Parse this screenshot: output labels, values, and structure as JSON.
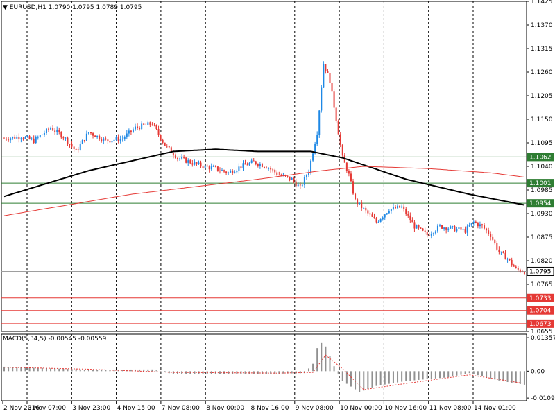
{
  "header": {
    "arrow": "▼",
    "symbol": "EURUSD,H1",
    "ohlc": "1.0790 1.0795 1.0789 1.0795"
  },
  "macd": {
    "label": "MACD(5,34,5)",
    "values": "-0.00545 -0.00559"
  },
  "colors": {
    "bull": "#1e88e5",
    "bear": "#e53935",
    "ma_slow": "#000000",
    "ma_fast": "#e53935",
    "support": "#e53935",
    "resistance": "#2e7d32",
    "current": "#9e9e9e"
  },
  "chart_data": {
    "type": "candlestick",
    "symbol": "EURUSD",
    "timeframe": "H1",
    "ylim": [
      1.0655,
      1.1425
    ],
    "y_ticks": [
      "1.1425",
      "1.1370",
      "1.1315",
      "1.1260",
      "1.1205",
      "1.1150",
      "1.1095",
      "1.1040",
      "1.0985",
      "1.0930",
      "1.0875",
      "1.0820",
      "1.0765",
      "1.0655"
    ],
    "x_ticks": [
      "2 Nov 2016",
      "3 Nov 07:00",
      "3 Nov 23:00",
      "4 Nov 15:00",
      "7 Nov 08:00",
      "8 Nov 00:00",
      "8 Nov 16:00",
      "9 Nov 08:00",
      "10 Nov 00:00",
      "10 Nov 16:00",
      "11 Nov 08:00",
      "14 Nov 01:00"
    ],
    "current_price": "1.0795",
    "levels": [
      {
        "value": "1.1062",
        "kind": "resistance"
      },
      {
        "value": "1.1001",
        "kind": "resistance"
      },
      {
        "value": "1.0954",
        "kind": "resistance"
      },
      {
        "value": "1.0733",
        "kind": "support"
      },
      {
        "value": "1.0704",
        "kind": "support"
      },
      {
        "value": "1.0673",
        "kind": "support"
      }
    ],
    "anchors": [
      [
        0,
        1.1105
      ],
      [
        8,
        1.111
      ],
      [
        14,
        1.11
      ],
      [
        22,
        1.113
      ],
      [
        28,
        1.111
      ],
      [
        34,
        1.1075
      ],
      [
        40,
        1.112
      ],
      [
        48,
        1.11
      ],
      [
        56,
        1.1105
      ],
      [
        62,
        1.113
      ],
      [
        70,
        1.114
      ],
      [
        76,
        1.109
      ],
      [
        82,
        1.106
      ],
      [
        88,
        1.105
      ],
      [
        94,
        1.104
      ],
      [
        100,
        1.1035
      ],
      [
        106,
        1.1025
      ],
      [
        112,
        1.104
      ],
      [
        118,
        1.105
      ],
      [
        124,
        1.104
      ],
      [
        130,
        1.102
      ],
      [
        136,
        1.101
      ],
      [
        140,
        1.099
      ],
      [
        144,
        1.103
      ],
      [
        148,
        1.112
      ],
      [
        151,
        1.128
      ],
      [
        154,
        1.124
      ],
      [
        157,
        1.115
      ],
      [
        160,
        1.106
      ],
      [
        163,
        1.102
      ],
      [
        166,
        1.096
      ],
      [
        170,
        1.094
      ],
      [
        176,
        1.091
      ],
      [
        182,
        1.094
      ],
      [
        188,
        1.0945
      ],
      [
        194,
        1.09
      ],
      [
        200,
        1.088
      ],
      [
        206,
        1.09
      ],
      [
        212,
        1.0895
      ],
      [
        218,
        1.089
      ],
      [
        222,
        1.091
      ],
      [
        226,
        1.09
      ],
      [
        230,
        1.088
      ],
      [
        234,
        1.084
      ],
      [
        238,
        1.0825
      ],
      [
        242,
        1.08
      ],
      [
        246,
        1.0795
      ]
    ],
    "ma_slow": [
      [
        0,
        1.097
      ],
      [
        40,
        1.103
      ],
      [
        80,
        1.1075
      ],
      [
        100,
        1.108
      ],
      [
        120,
        1.1075
      ],
      [
        145,
        1.1075
      ],
      [
        160,
        1.106
      ],
      [
        190,
        1.101
      ],
      [
        220,
        1.0975
      ],
      [
        246,
        1.095
      ]
    ],
    "ma_fast": [
      [
        0,
        1.0925
      ],
      [
        60,
        1.0975
      ],
      [
        120,
        1.101
      ],
      [
        150,
        1.103
      ],
      [
        170,
        1.104
      ],
      [
        200,
        1.1035
      ],
      [
        230,
        1.1025
      ],
      [
        246,
        1.1015
      ]
    ],
    "macd_ylim": [
      -0.012,
      0.015
    ],
    "macd_ticks": [
      "0.01357",
      "0.00",
      "-0.01091"
    ],
    "macd_anchors": [
      [
        0,
        0.0018
      ],
      [
        40,
        0.0006
      ],
      [
        70,
        0.0007
      ],
      [
        80,
        -0.0012
      ],
      [
        100,
        -0.0012
      ],
      [
        130,
        -0.001
      ],
      [
        142,
        -0.0008
      ],
      [
        146,
        0.003
      ],
      [
        149,
        0.0125
      ],
      [
        152,
        0.01
      ],
      [
        156,
        0.002
      ],
      [
        160,
        -0.004
      ],
      [
        168,
        -0.0085
      ],
      [
        176,
        -0.006
      ],
      [
        190,
        -0.004
      ],
      [
        210,
        -0.0025
      ],
      [
        220,
        -0.0008
      ],
      [
        235,
        -0.004
      ],
      [
        246,
        -0.0055
      ]
    ],
    "macd_signal_anchors": [
      [
        0,
        0.0016
      ],
      [
        40,
        0.0008
      ],
      [
        80,
        -0.0005
      ],
      [
        130,
        -0.0008
      ],
      [
        146,
        -0.0005
      ],
      [
        152,
        0.0065
      ],
      [
        160,
        0.001
      ],
      [
        170,
        -0.0075
      ],
      [
        190,
        -0.005
      ],
      [
        220,
        -0.0015
      ],
      [
        246,
        -0.005
      ]
    ]
  }
}
